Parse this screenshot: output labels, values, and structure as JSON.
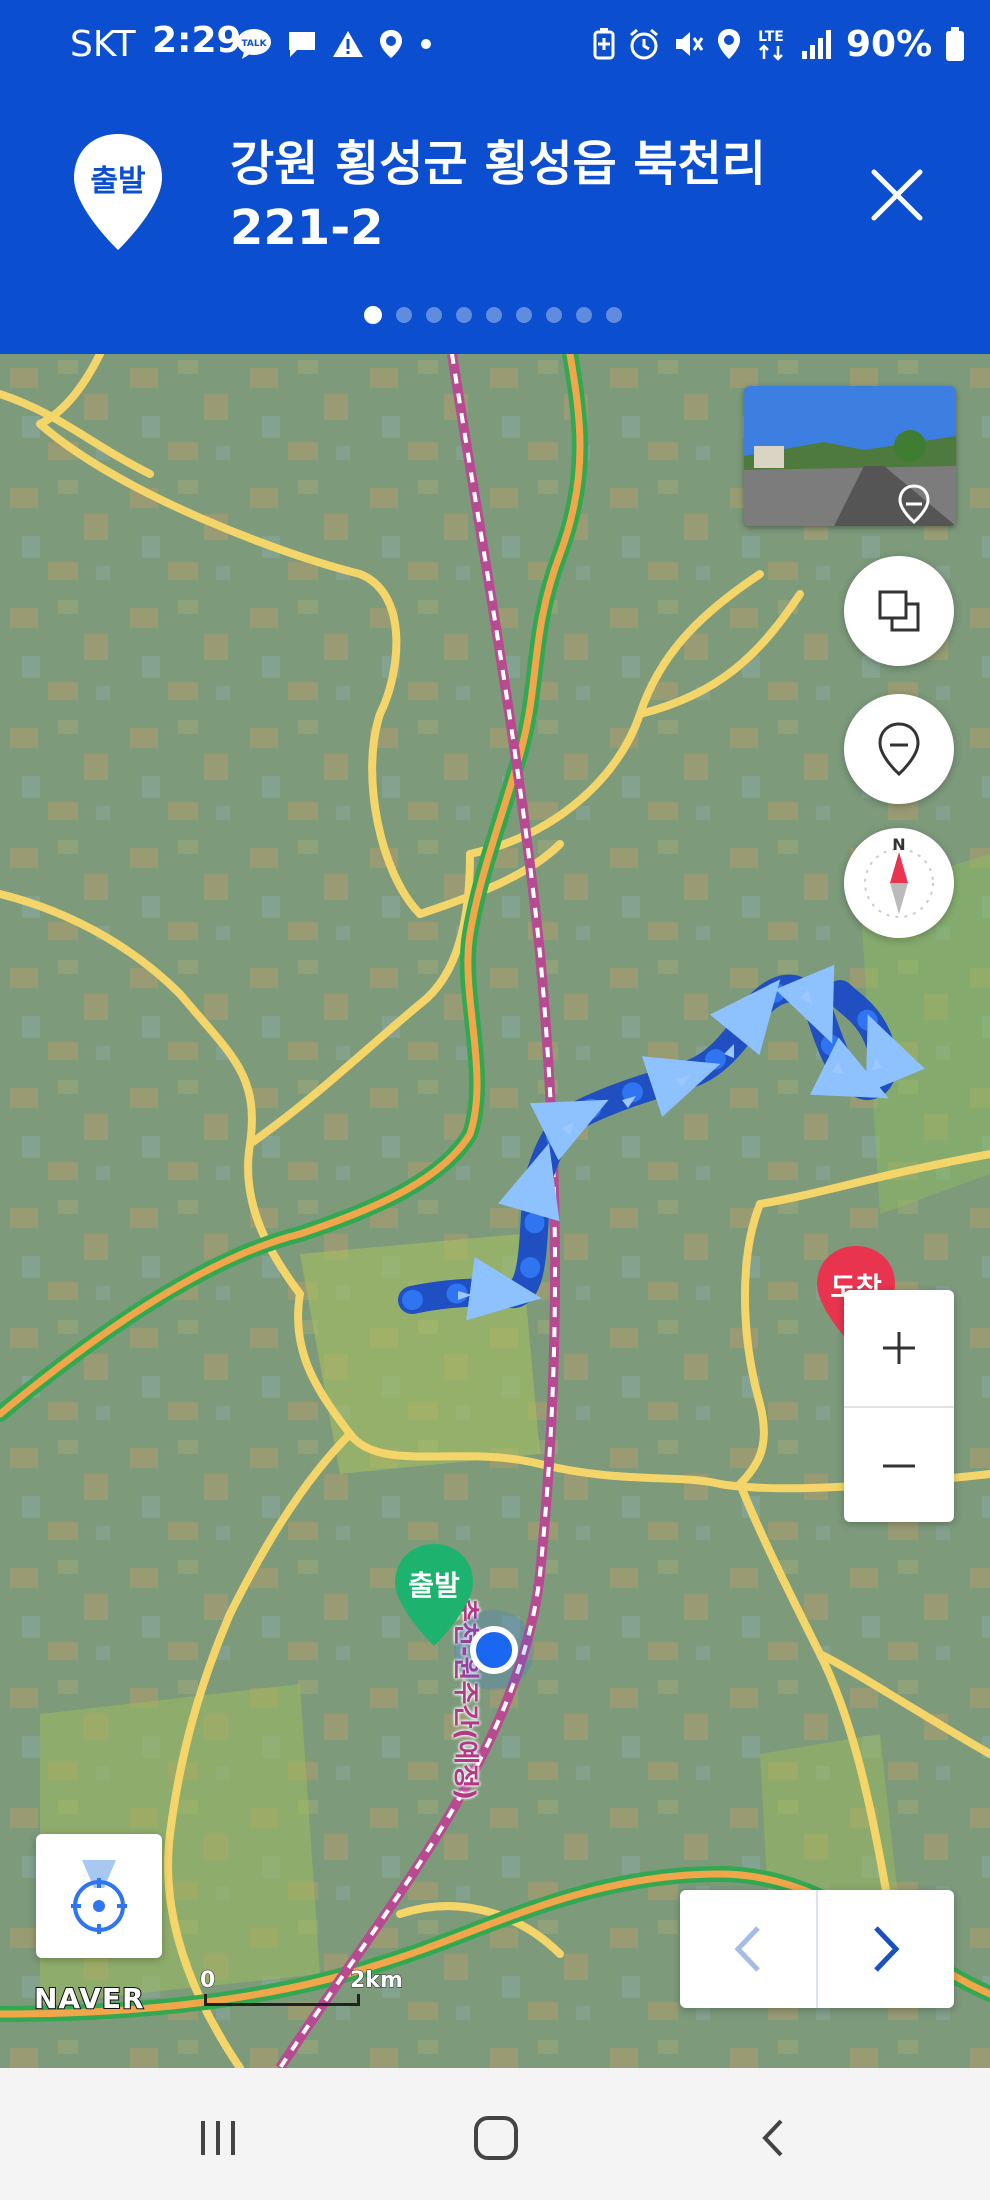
{
  "status_bar": {
    "carrier": "SKT",
    "time": "2:29",
    "left_icons": [
      "kakaotalk-icon",
      "message-icon",
      "warning-icon",
      "location-pin-icon",
      "dot-icon"
    ],
    "right_icons": [
      "battery-saver-icon",
      "alarm-icon",
      "mute-icon",
      "location-icon",
      "lte-icon",
      "signal-icon"
    ],
    "network": "LTE",
    "battery": "90%"
  },
  "header": {
    "origin_badge": "출발",
    "address": "강원 횡성군 횡성읍 북천리 221-2",
    "page_count": 9,
    "active_page": 1,
    "background_color": "#0b4fd0"
  },
  "map": {
    "rail_label": "춘천-원주간(예정)",
    "start_marker": "출발",
    "end_marker": "도착",
    "route_color": "#1e62e0",
    "scale": {
      "min": "0",
      "max": "2km"
    },
    "logo": "NAVER",
    "controls": [
      "streetview-thumbnail",
      "layers-button",
      "map-pin-button",
      "compass-button",
      "zoom-in-button",
      "zoom-out-button",
      "my-location-button",
      "previous-button",
      "next-button"
    ]
  },
  "navbar": {
    "buttons": [
      "recent-apps",
      "home",
      "back"
    ]
  }
}
